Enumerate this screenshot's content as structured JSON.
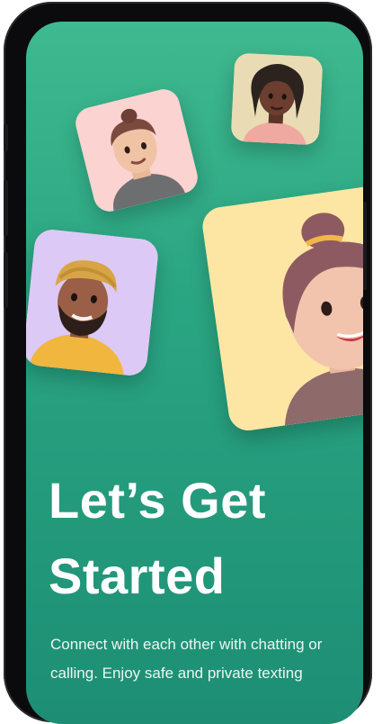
{
  "onboarding": {
    "title_line1": "Let’s Get",
    "title_line2": "Started",
    "subtitle_line1": "Connect with each other with chatting or",
    "subtitle_line2": "calling. Enjoy safe and private texting"
  },
  "colors": {
    "background_top": "#3fb98f",
    "background_bottom": "#1d8e74",
    "card_pink": "#fbd3d1",
    "card_lavender": "#dcc9f5",
    "card_beige": "#e9dcb4",
    "card_yellow": "#fde6a3"
  },
  "avatars": [
    {
      "name": "avatar-man-beard-turban"
    },
    {
      "name": "avatar-man-bun"
    },
    {
      "name": "avatar-woman-dreadlocks"
    },
    {
      "name": "avatar-woman-ponytail"
    }
  ]
}
